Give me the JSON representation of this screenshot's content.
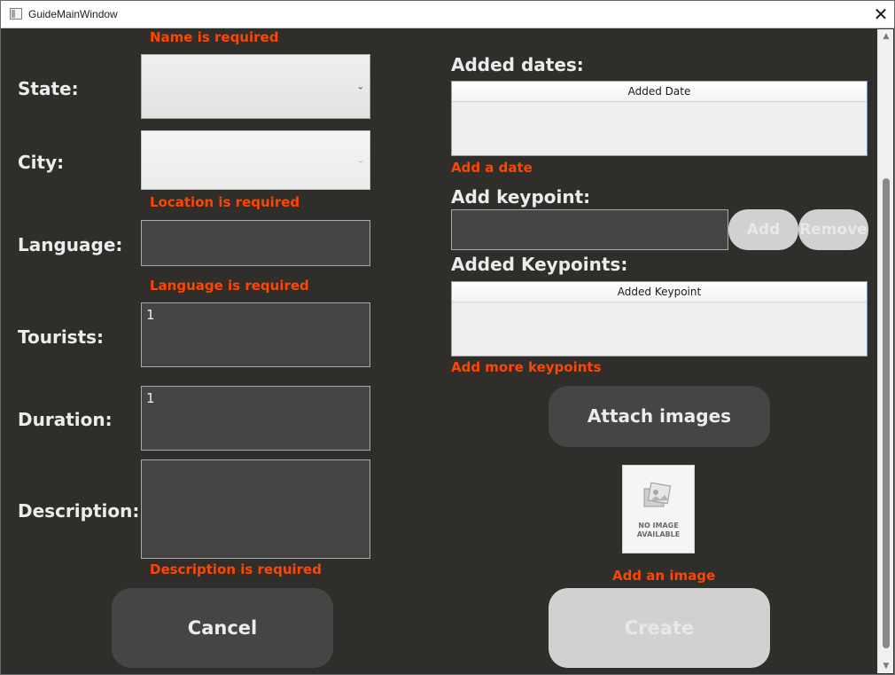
{
  "window": {
    "title": "GuideMainWindow",
    "close_glyph": "✕",
    "app_icon": "window-icon"
  },
  "errors": {
    "name": "Name is required",
    "location": "Location is required",
    "language": "Language is required",
    "description": "Description is required",
    "dates": "Add a date",
    "keypoints": "Add more keypoints",
    "image": "Add an image"
  },
  "form": {
    "state_label": "State:",
    "city_label": "City:",
    "language_label": "Language:",
    "language_value": "",
    "tourists_label": "Tourists:",
    "tourists_value": "1",
    "duration_label": "Duration:",
    "duration_value": "1",
    "description_label": "Description:",
    "description_value": ""
  },
  "dates": {
    "title": "Added dates:",
    "column": "Added Date"
  },
  "keypoint": {
    "title": "Add keypoint:",
    "input_value": "",
    "add_label": "Add",
    "remove_label": "Remove"
  },
  "keypoints": {
    "title": "Added Keypoints:",
    "column": "Added Keypoint"
  },
  "attach_label": "Attach images",
  "image_placeholder": {
    "text_line1": "NO IMAGE",
    "text_line2": "AVAILABLE"
  },
  "buttons": {
    "cancel_label": "Cancel",
    "create_label": "Create"
  },
  "colors": {
    "background": "#2f2e2a",
    "error": "#ff4500",
    "button_dark": "#454545",
    "button_disabled": "#d1d1d1"
  }
}
